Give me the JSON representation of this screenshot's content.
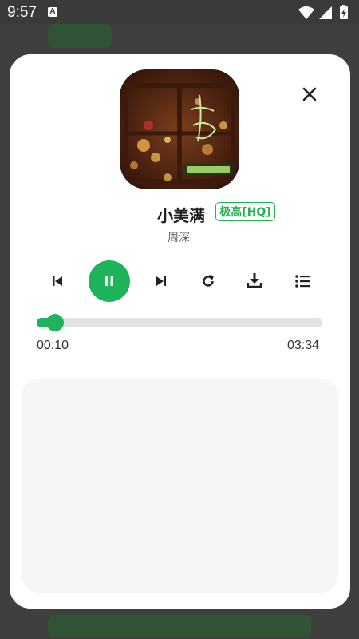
{
  "status_bar": {
    "time": "9:57",
    "notification_badge": "A",
    "icons": [
      "wifi-icon",
      "signal-icon",
      "battery-charging-icon"
    ]
  },
  "player": {
    "song_title": "小美满",
    "quality_badge": "极高[HQ]",
    "artist": "周深",
    "current_time": "00:10",
    "total_time": "03:34",
    "progress_fraction": 0.047,
    "accent_color": "#1fb35a",
    "controls": [
      "previous-icon",
      "pause-icon",
      "next-icon",
      "repeat-icon",
      "download-icon",
      "playlist-icon"
    ]
  }
}
